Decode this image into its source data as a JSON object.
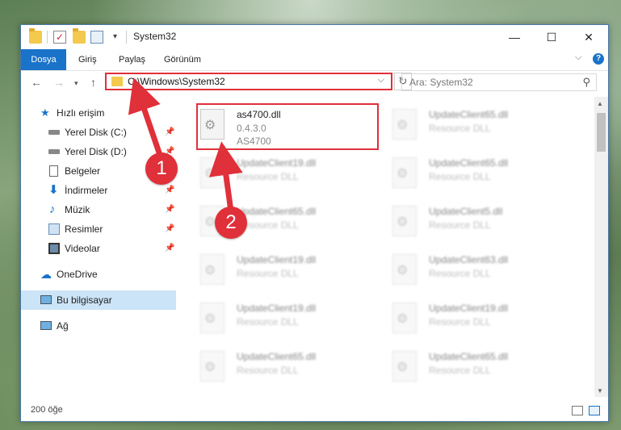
{
  "window": {
    "title": "System32",
    "controls": {
      "minimize": "—",
      "maximize": "☐",
      "close": "✕"
    }
  },
  "ribbon": {
    "tabs": [
      "Dosya",
      "Giriş",
      "Paylaş",
      "Görünüm"
    ],
    "help": "?"
  },
  "nav": {
    "address_path": "C:\\Windows\\System32",
    "search_placeholder": "Ara: System32"
  },
  "sidebar": {
    "items": [
      {
        "label": "Hızlı erişim",
        "icon": "star-icon"
      },
      {
        "label": "Yerel Disk (C:)",
        "icon": "drive-icon",
        "pinned": true
      },
      {
        "label": "Yerel Disk (D:)",
        "icon": "drive-icon",
        "pinned": true
      },
      {
        "label": "Belgeler",
        "icon": "documents-icon",
        "pinned": true
      },
      {
        "label": "İndirmeler",
        "icon": "download-icon",
        "pinned": true
      },
      {
        "label": "Müzik",
        "icon": "music-icon",
        "pinned": true
      },
      {
        "label": "Resimler",
        "icon": "pictures-icon",
        "pinned": true
      },
      {
        "label": "Videolar",
        "icon": "videos-icon",
        "pinned": true
      },
      {
        "label": "OneDrive",
        "icon": "cloud-icon"
      },
      {
        "label": "Bu bilgisayar",
        "icon": "computer-icon",
        "selected": true
      },
      {
        "label": "Ağ",
        "icon": "network-icon"
      }
    ]
  },
  "files": {
    "highlighted": {
      "name": "as4700.dll",
      "version": "0.4.3.0",
      "description": "AS4700"
    },
    "left_column": [
      {
        "name": "UpdateClient19.dll",
        "type": "Resource DLL"
      },
      {
        "name": "UpdateClient65.dll",
        "type": "Resource DLL"
      },
      {
        "name": "UpdateClient19.dll",
        "type": "Resource DLL"
      },
      {
        "name": "UpdateClient19.dll",
        "type": "Resource DLL"
      },
      {
        "name": "UpdateClient65.dll",
        "type": "Resource DLL"
      }
    ],
    "right_column": [
      {
        "name": "UpdateClient65.dll",
        "type": "Resource DLL"
      },
      {
        "name": "UpdateClient65.dll",
        "type": "Resource DLL"
      },
      {
        "name": "UpdateClient5.dll",
        "type": "Resource DLL"
      },
      {
        "name": "UpdateClient63.dll",
        "type": "Resource DLL"
      },
      {
        "name": "UpdateClient19.dll",
        "type": "Resource DLL"
      },
      {
        "name": "UpdateClient65.dll",
        "type": "Resource DLL"
      }
    ]
  },
  "status": {
    "count": "200 öğe"
  },
  "annotations": {
    "step1": "1",
    "step2": "2",
    "color": "#e0303a"
  }
}
